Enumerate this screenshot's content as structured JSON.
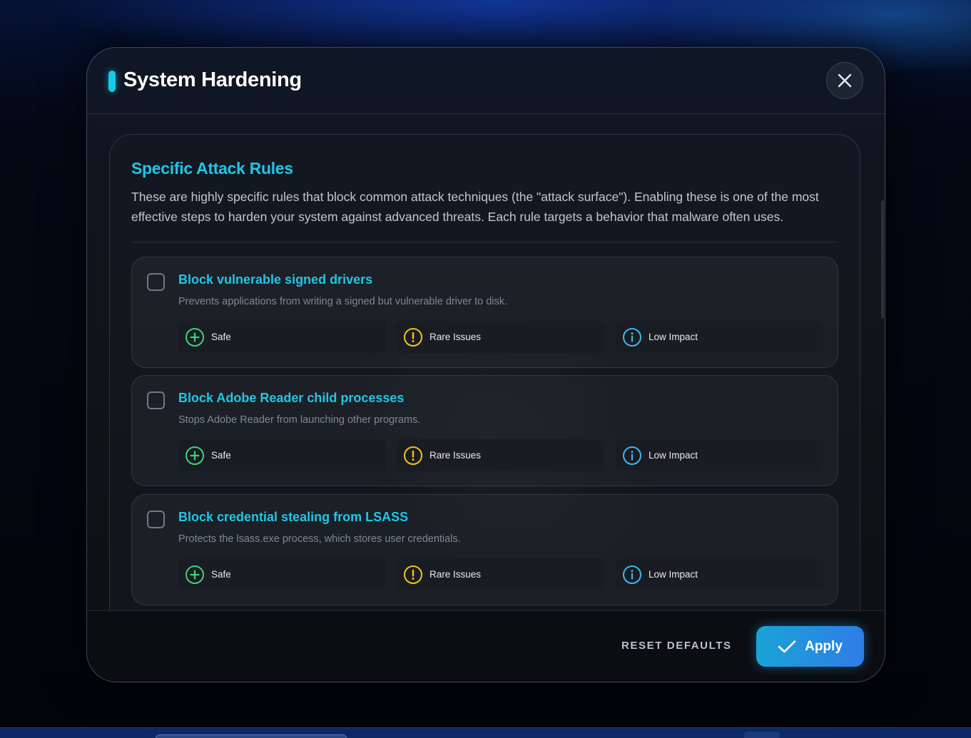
{
  "modal": {
    "title": "System Hardening",
    "close_icon": "close-icon"
  },
  "section": {
    "title": "Specific Attack Rules",
    "description": "These are highly specific rules that block common attack techniques (the \"attack surface\"). Enabling these is one of the most effective steps to harden your system against advanced threats. Each rule targets a behavior that malware often uses."
  },
  "rules": [
    {
      "title": "Block vulnerable signed drivers",
      "description": "Prevents applications from writing a signed but vulnerable driver to disk.",
      "checked": false,
      "badges": [
        {
          "label": "Safe",
          "icon": "plus-circle-icon",
          "color": "#3fd17a"
        },
        {
          "label": "Rare Issues",
          "icon": "exclamation-circle-icon",
          "color": "#f2c418"
        },
        {
          "label": "Low Impact",
          "icon": "info-circle-icon",
          "color": "#3fb6f0"
        }
      ]
    },
    {
      "title": "Block Adobe Reader child processes",
      "description": "Stops Adobe Reader from launching other programs.",
      "checked": false,
      "badges": [
        {
          "label": "Safe",
          "icon": "plus-circle-icon",
          "color": "#3fd17a"
        },
        {
          "label": "Rare Issues",
          "icon": "exclamation-circle-icon",
          "color": "#f2c418"
        },
        {
          "label": "Low Impact",
          "icon": "info-circle-icon",
          "color": "#3fb6f0"
        }
      ]
    },
    {
      "title": "Block credential stealing from LSASS",
      "description": "Protects the lsass.exe process, which stores user credentials.",
      "checked": false,
      "badges": [
        {
          "label": "Safe",
          "icon": "plus-circle-icon",
          "color": "#3fd17a"
        },
        {
          "label": "Rare Issues",
          "icon": "exclamation-circle-icon",
          "color": "#f2c418"
        },
        {
          "label": "Low Impact",
          "icon": "info-circle-icon",
          "color": "#3fb6f0"
        }
      ]
    }
  ],
  "footer": {
    "reset_label": "RESET DEFAULTS",
    "apply_label": "Apply"
  },
  "colors": {
    "accent": "#22c5e6",
    "apply_gradient_start": "#1aa3d6",
    "apply_gradient_end": "#2f7de8"
  }
}
